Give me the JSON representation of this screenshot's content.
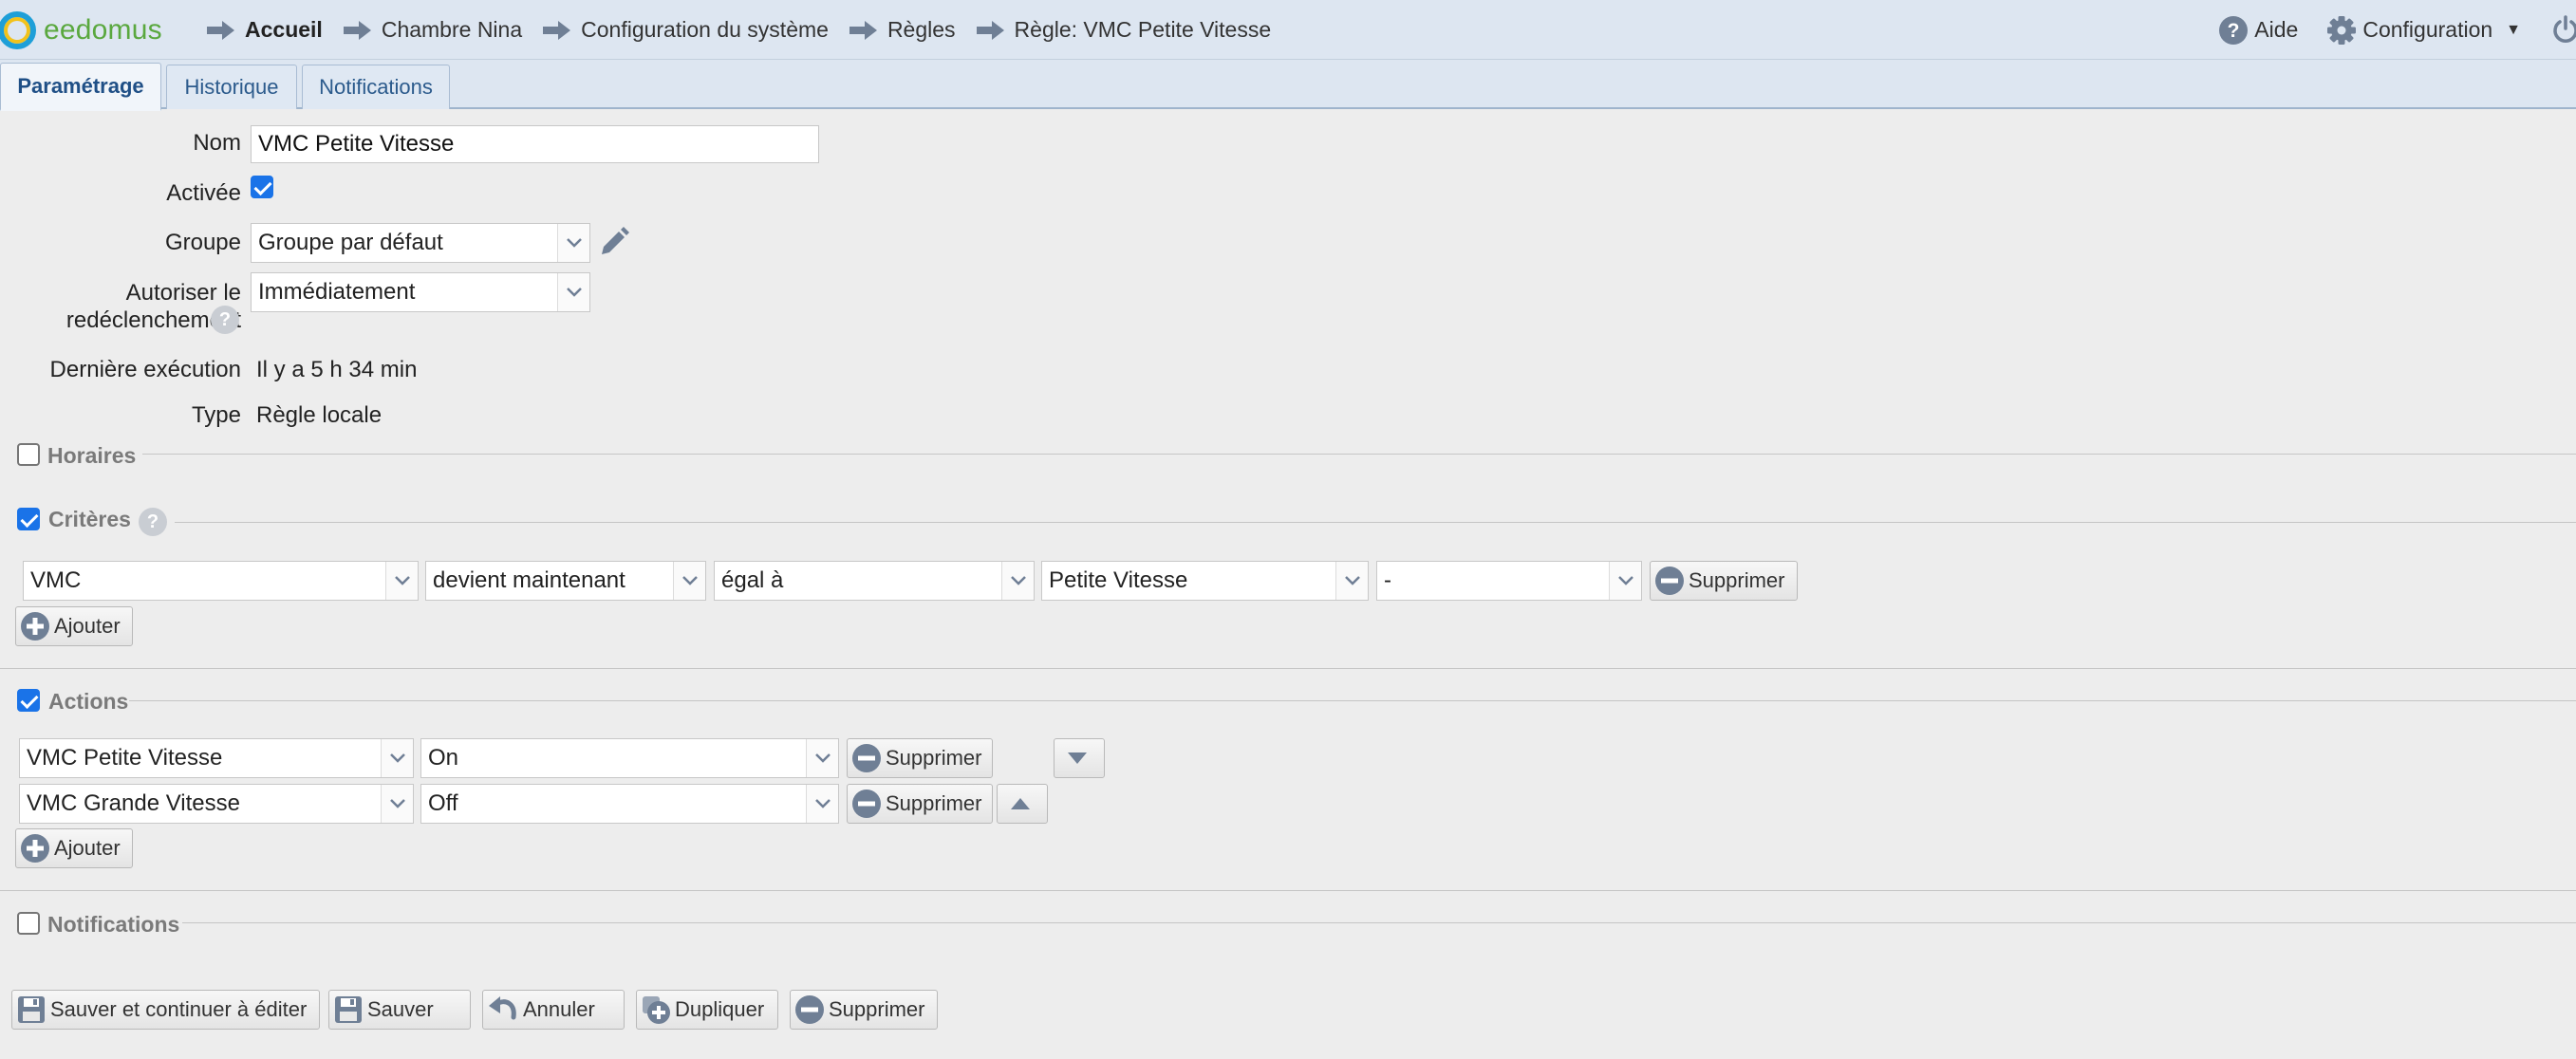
{
  "app": {
    "logo_text": "eedomus"
  },
  "breadcrumb": [
    {
      "label": "Accueil"
    },
    {
      "label": "Chambre Nina"
    },
    {
      "label": "Configuration du système"
    },
    {
      "label": "Règles"
    },
    {
      "label": "Règle: VMC Petite Vitesse"
    }
  ],
  "topright": {
    "help_label": "Aide",
    "config_label": "Configuration"
  },
  "tabs": [
    {
      "label": "Paramétrage",
      "active": true
    },
    {
      "label": "Historique"
    },
    {
      "label": "Notifications"
    }
  ],
  "form": {
    "nom_label": "Nom",
    "nom_value": "VMC Petite Vitesse",
    "activee_label": "Activée",
    "activee_checked": true,
    "groupe_label": "Groupe",
    "groupe_value": "Groupe par défaut",
    "redecl_label_line1": "Autoriser le",
    "redecl_label_line2": "redéclenchement",
    "redecl_value": "Immédiatement",
    "derniere_label": "Dernière exécution",
    "derniere_value": "Il y a 5 h 34 min",
    "type_label": "Type",
    "type_value": "Règle locale"
  },
  "sections": {
    "horaires": {
      "title": "Horaires",
      "checked": false
    },
    "criteres": {
      "title": "Critères",
      "checked": true
    },
    "actions": {
      "title": "Actions",
      "checked": true
    },
    "notifications": {
      "title": "Notifications",
      "checked": false
    }
  },
  "criteria": {
    "device": "VMC",
    "event": "devient maintenant",
    "operator": "égal à",
    "value": "Petite Vitesse",
    "extra": "-",
    "delete_label": "Supprimer",
    "add_label": "Ajouter"
  },
  "actions": {
    "rows": [
      {
        "device": "VMC Petite Vitesse",
        "value": "On",
        "delete_label": "Supprimer"
      },
      {
        "device": "VMC Grande Vitesse",
        "value": "Off",
        "delete_label": "Supprimer"
      }
    ],
    "add_label": "Ajouter"
  },
  "footer": {
    "save_continue": "Sauver et continuer à éditer",
    "save": "Sauver",
    "cancel": "Annuler",
    "duplicate": "Dupliquer",
    "delete": "Supprimer"
  },
  "colors": {
    "accent": "#1a73e8",
    "tabbar": "#dde6f1",
    "icon": "#5f7390"
  }
}
